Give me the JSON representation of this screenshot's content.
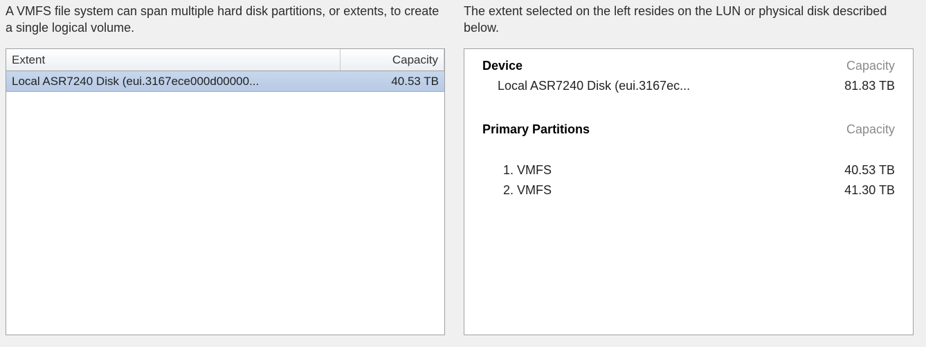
{
  "left": {
    "description": "A VMFS file system can span multiple hard disk partitions, or extents, to create a single logical volume.",
    "columns": {
      "extent": "Extent",
      "capacity": "Capacity"
    },
    "rows": [
      {
        "extent": "Local ASR7240 Disk (eui.3167ece000d00000...",
        "capacity": "40.53 TB"
      }
    ]
  },
  "right": {
    "description": "The extent selected on the left resides on the LUN or physical disk described below.",
    "device": {
      "heading": "Device",
      "capacity_label": "Capacity",
      "name": "Local ASR7240 Disk (eui.3167ec...",
      "capacity": "81.83 TB"
    },
    "partitions": {
      "heading": "Primary Partitions",
      "capacity_label": "Capacity",
      "items": [
        {
          "label": "1. VMFS",
          "capacity": "40.53 TB"
        },
        {
          "label": "2. VMFS",
          "capacity": "41.30 TB"
        }
      ]
    }
  }
}
